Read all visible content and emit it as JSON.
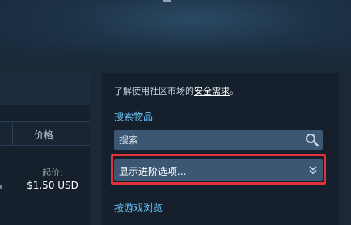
{
  "market": {
    "note_prefix": "了解使用社区市场的",
    "note_link": "安全需求",
    "note_suffix": "。",
    "search_section_title": "搜索物品",
    "search_placeholder": "搜索",
    "advanced_options_label": "显示进阶选项...",
    "browse_by_game_title": "按游戏浏览"
  },
  "listing": {
    "price_header": "价格",
    "starting_at_label": "起价:",
    "price_value": "$1.50 USD"
  },
  "colors": {
    "background": "#1b2838",
    "panel": "#16202d",
    "input": "#3c5773",
    "accent_blue": "#67c1f5",
    "highlight_red": "#e0323b"
  },
  "icons": {
    "search": "magnifier",
    "advanced_toggle": "double-chevron-down"
  }
}
